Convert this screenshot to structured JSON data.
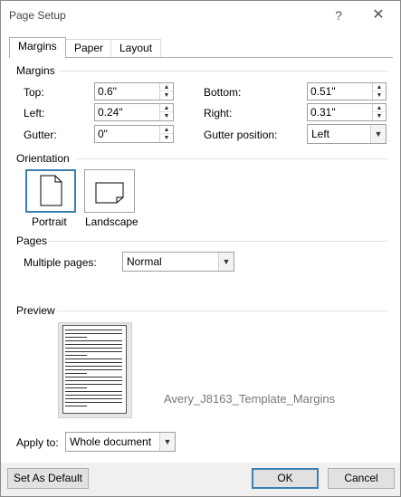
{
  "window": {
    "title": "Page Setup",
    "help_glyph": "?",
    "close_glyph": "✕"
  },
  "tabs": [
    {
      "label": "Margins",
      "active": true
    },
    {
      "label": "Paper",
      "active": false
    },
    {
      "label": "Layout",
      "active": false
    }
  ],
  "margins": {
    "section_title": "Margins",
    "top": {
      "label": "Top:",
      "value": "0.6\""
    },
    "bottom": {
      "label": "Bottom:",
      "value": "0.51\""
    },
    "left": {
      "label": "Left:",
      "value": "0.24\""
    },
    "right": {
      "label": "Right:",
      "value": "0.31\""
    },
    "gutter": {
      "label": "Gutter:",
      "value": "0\""
    },
    "gutter_position": {
      "label": "Gutter position:",
      "value": "Left"
    }
  },
  "orientation": {
    "section_title": "Orientation",
    "portrait_label": "Portrait",
    "landscape_label": "Landscape",
    "selected": "Portrait"
  },
  "pages": {
    "section_title": "Pages",
    "multiple_pages_label": "Multiple pages:",
    "multiple_pages_value": "Normal"
  },
  "preview": {
    "section_title": "Preview",
    "name": "Avery_J8163_Template_Margins"
  },
  "apply_to": {
    "label": "Apply to:",
    "value": "Whole document"
  },
  "buttons": {
    "set_default": "Set As Default",
    "ok": "OK",
    "cancel": "Cancel"
  },
  "colors": {
    "accent": "#3c7fb1",
    "footer_bg": "#f0f0f0"
  }
}
